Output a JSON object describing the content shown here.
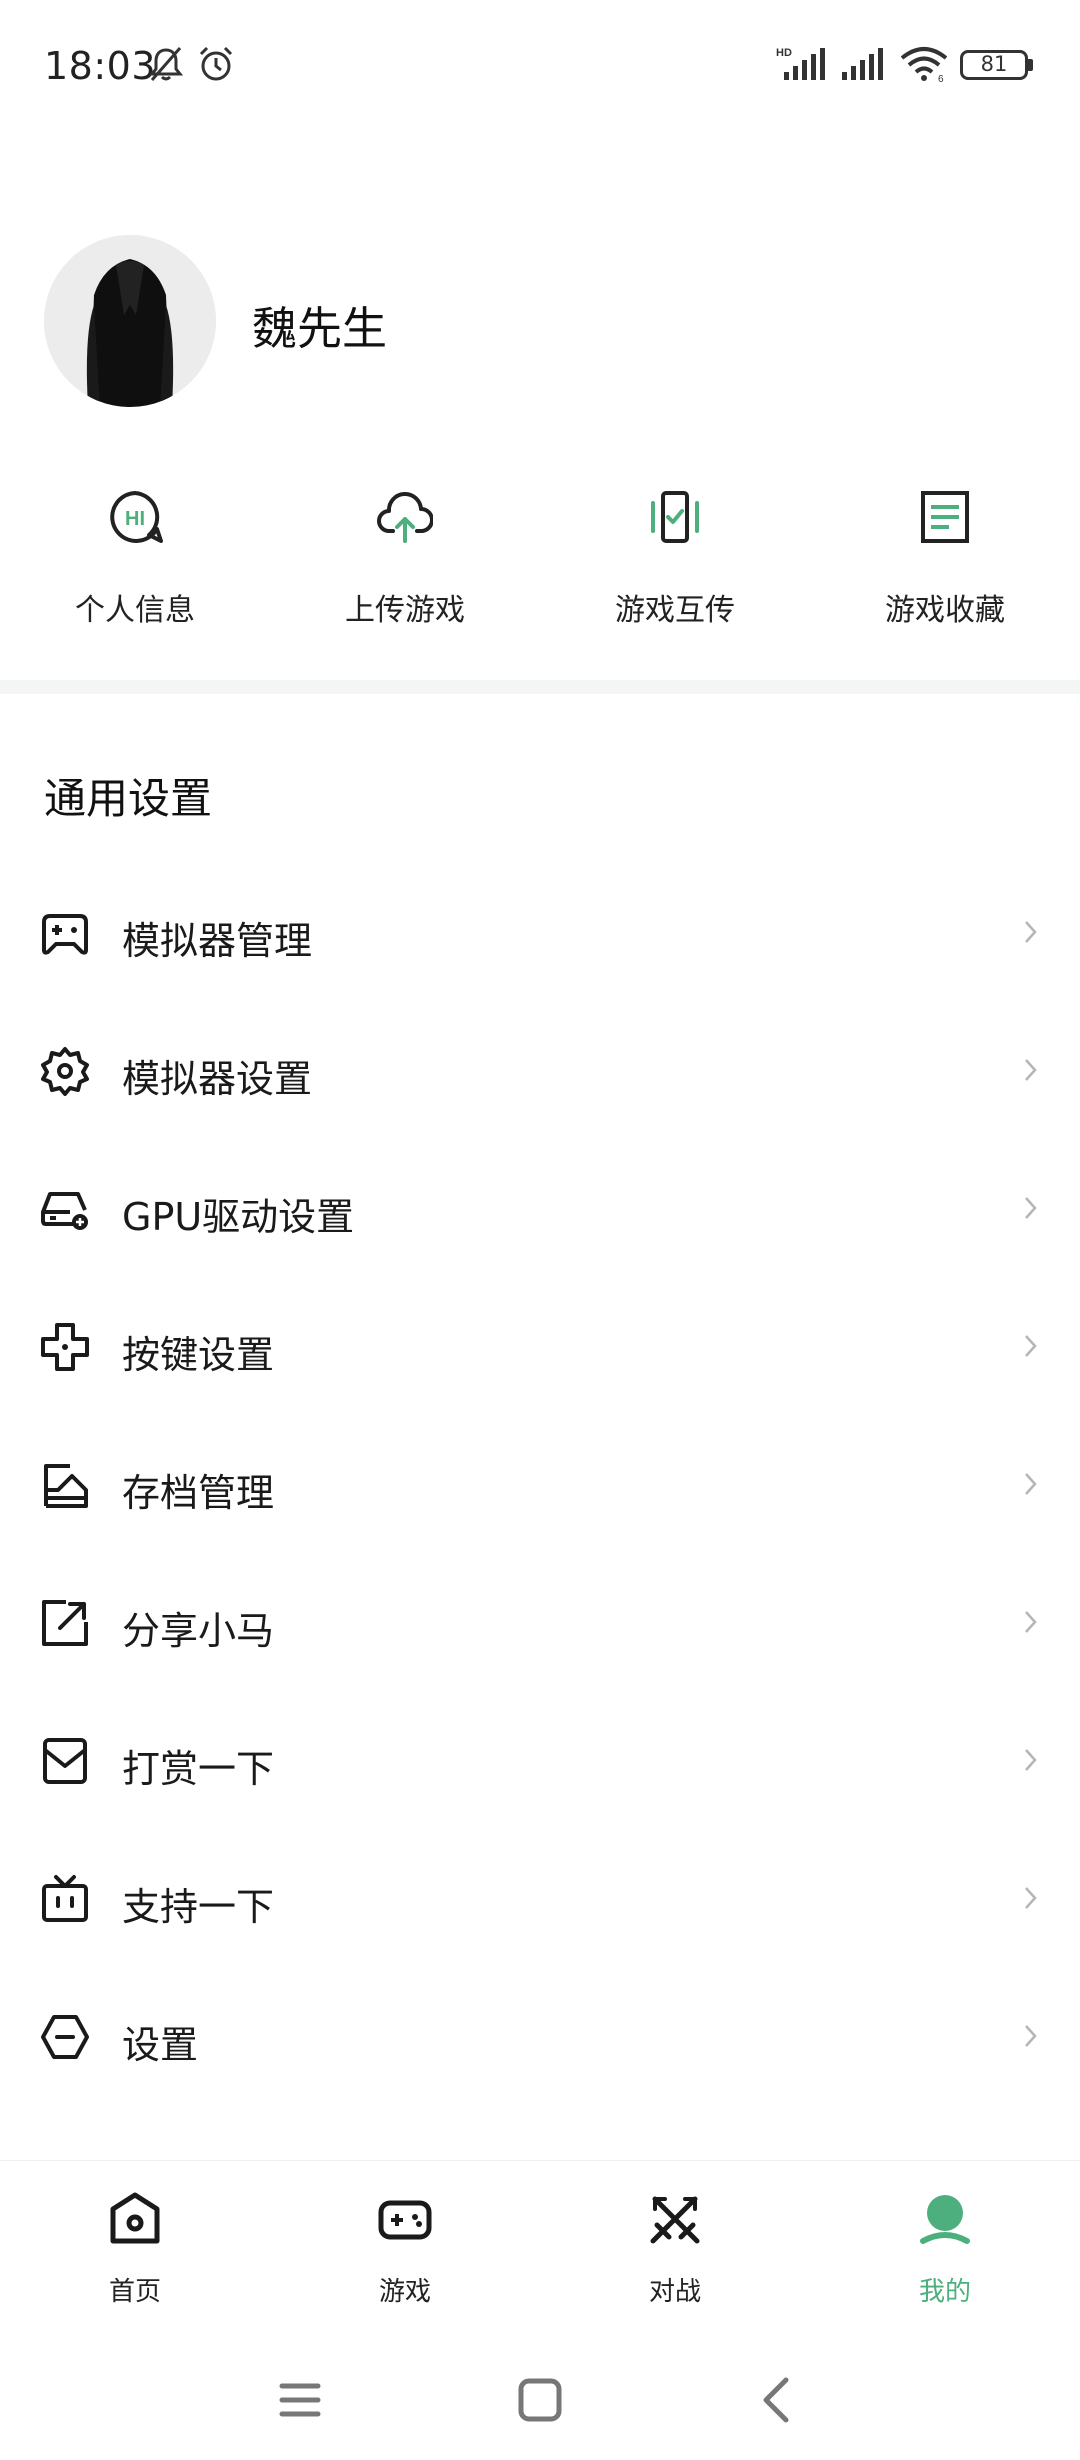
{
  "status_bar": {
    "time": "18:03",
    "battery": "81",
    "icons": [
      "mute-bell-icon",
      "alarm-icon",
      "hd-signal-icon",
      "signal-icon",
      "wifi-icon",
      "battery-icon"
    ]
  },
  "profile": {
    "name": "魏先生",
    "avatar": "avatar-photo"
  },
  "quick_actions": [
    {
      "label": "个人信息",
      "icon": "chat-hi-icon"
    },
    {
      "label": "上传游戏",
      "icon": "cloud-upload-icon"
    },
    {
      "label": "游戏互传",
      "icon": "phone-transfer-icon"
    },
    {
      "label": "游戏收藏",
      "icon": "list-doc-icon"
    }
  ],
  "general_settings": {
    "title": "通用设置",
    "items": [
      {
        "label": "模拟器管理",
        "icon": "gamepad-icon"
      },
      {
        "label": "模拟器设置",
        "icon": "gear-icon"
      },
      {
        "label": "GPU驱动设置",
        "icon": "drive-icon"
      },
      {
        "label": "按键设置",
        "icon": "dpad-icon"
      },
      {
        "label": "存档管理",
        "icon": "archive-icon"
      },
      {
        "label": "分享小马",
        "icon": "share-icon"
      },
      {
        "label": "打赏一下",
        "icon": "reward-icon"
      },
      {
        "label": "支持一下",
        "icon": "tv-icon"
      },
      {
        "label": "设置",
        "icon": "settings-hex-icon"
      }
    ]
  },
  "bottom_nav": [
    {
      "label": "首页",
      "icon": "home-icon",
      "active": false
    },
    {
      "label": "游戏",
      "icon": "gamepad-icon",
      "active": false
    },
    {
      "label": "对战",
      "icon": "battle-icon",
      "active": false
    },
    {
      "label": "我的",
      "icon": "profile-icon",
      "active": true
    }
  ],
  "colors": {
    "accent": "#4caf7d",
    "text": "#111111",
    "muted": "#b5b5b5",
    "divider": "#f4f5f5"
  }
}
